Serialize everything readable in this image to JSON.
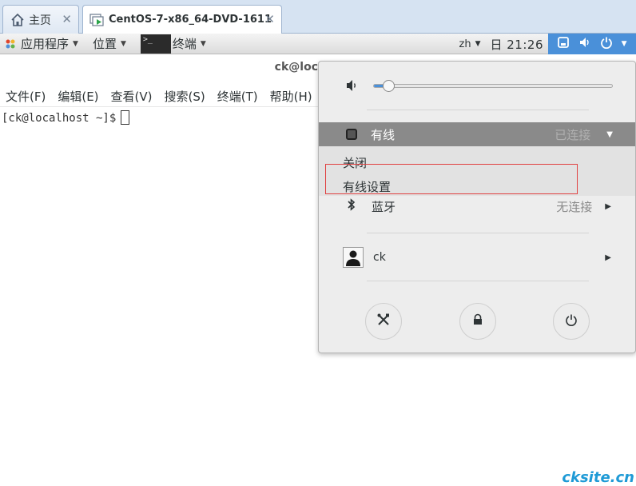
{
  "tabs": [
    {
      "label": "主页",
      "icon": "home-icon"
    },
    {
      "label": "CentOS-7-x86_64-DVD-1611",
      "icon": "vm-icon"
    }
  ],
  "topbar": {
    "apps_label": "应用程序",
    "places_label": "位置",
    "terminal_label": "终端",
    "lang": "zh",
    "clock": "日 21:26"
  },
  "terminal": {
    "title": "ck@loc",
    "menu": [
      "文件(F)",
      "编辑(E)",
      "查看(V)",
      "搜索(S)",
      "终端(T)",
      "帮助(H)"
    ],
    "prompt": "[ck@localhost ~]$"
  },
  "system_menu": {
    "volume": {
      "level": 0.06
    },
    "wired": {
      "label": "有线",
      "status": "已连接"
    },
    "wired_submenu": [
      "关闭",
      "有线设置"
    ],
    "bluetooth": {
      "label": "蓝牙",
      "status": "无连接"
    },
    "user": {
      "name": "ck"
    },
    "buttons": [
      "settings",
      "lock",
      "power-off"
    ]
  },
  "colors": {
    "accent": "#4a90d9",
    "highlight_box": "#e04040",
    "watermark": "#1e9ad6"
  },
  "watermark": "cksite.cn"
}
